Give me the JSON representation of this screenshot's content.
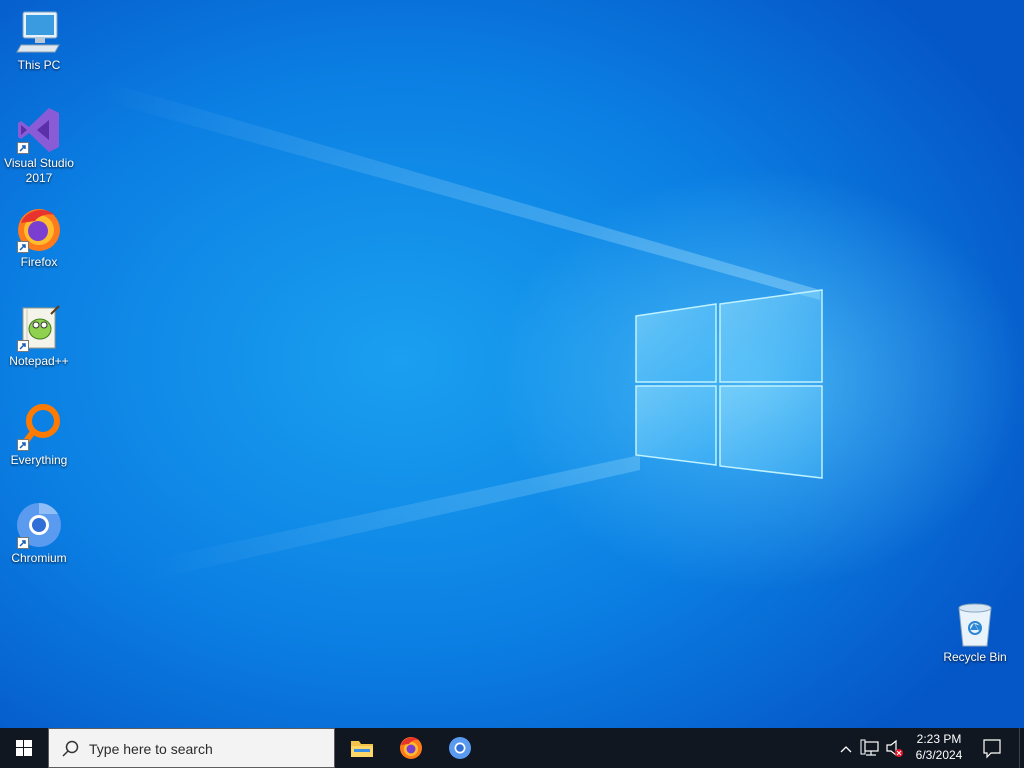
{
  "desktop": {
    "icons": [
      {
        "label": "This PC",
        "icon": "computer-icon"
      },
      {
        "label": "Visual Studio 2017",
        "icon": "visual-studio-icon"
      },
      {
        "label": "Firefox",
        "icon": "firefox-icon"
      },
      {
        "label": "Notepad++",
        "icon": "notepadpp-icon"
      },
      {
        "label": "Everything",
        "icon": "everything-search-icon"
      },
      {
        "label": "Chromium",
        "icon": "chromium-icon"
      },
      {
        "label": "Recycle Bin",
        "icon": "recycle-bin-icon"
      }
    ]
  },
  "taskbar": {
    "search_placeholder": "Type here to search",
    "pinned": [
      {
        "name": "File Explorer",
        "icon": "folder-icon"
      },
      {
        "name": "Firefox",
        "icon": "firefox-icon"
      },
      {
        "name": "Chromium",
        "icon": "chromium-icon"
      }
    ],
    "clock": {
      "time": "2:23 PM",
      "date": "6/3/2024"
    }
  },
  "colors": {
    "wallpaper": "#0a6fd8",
    "taskbar": "#101721"
  }
}
